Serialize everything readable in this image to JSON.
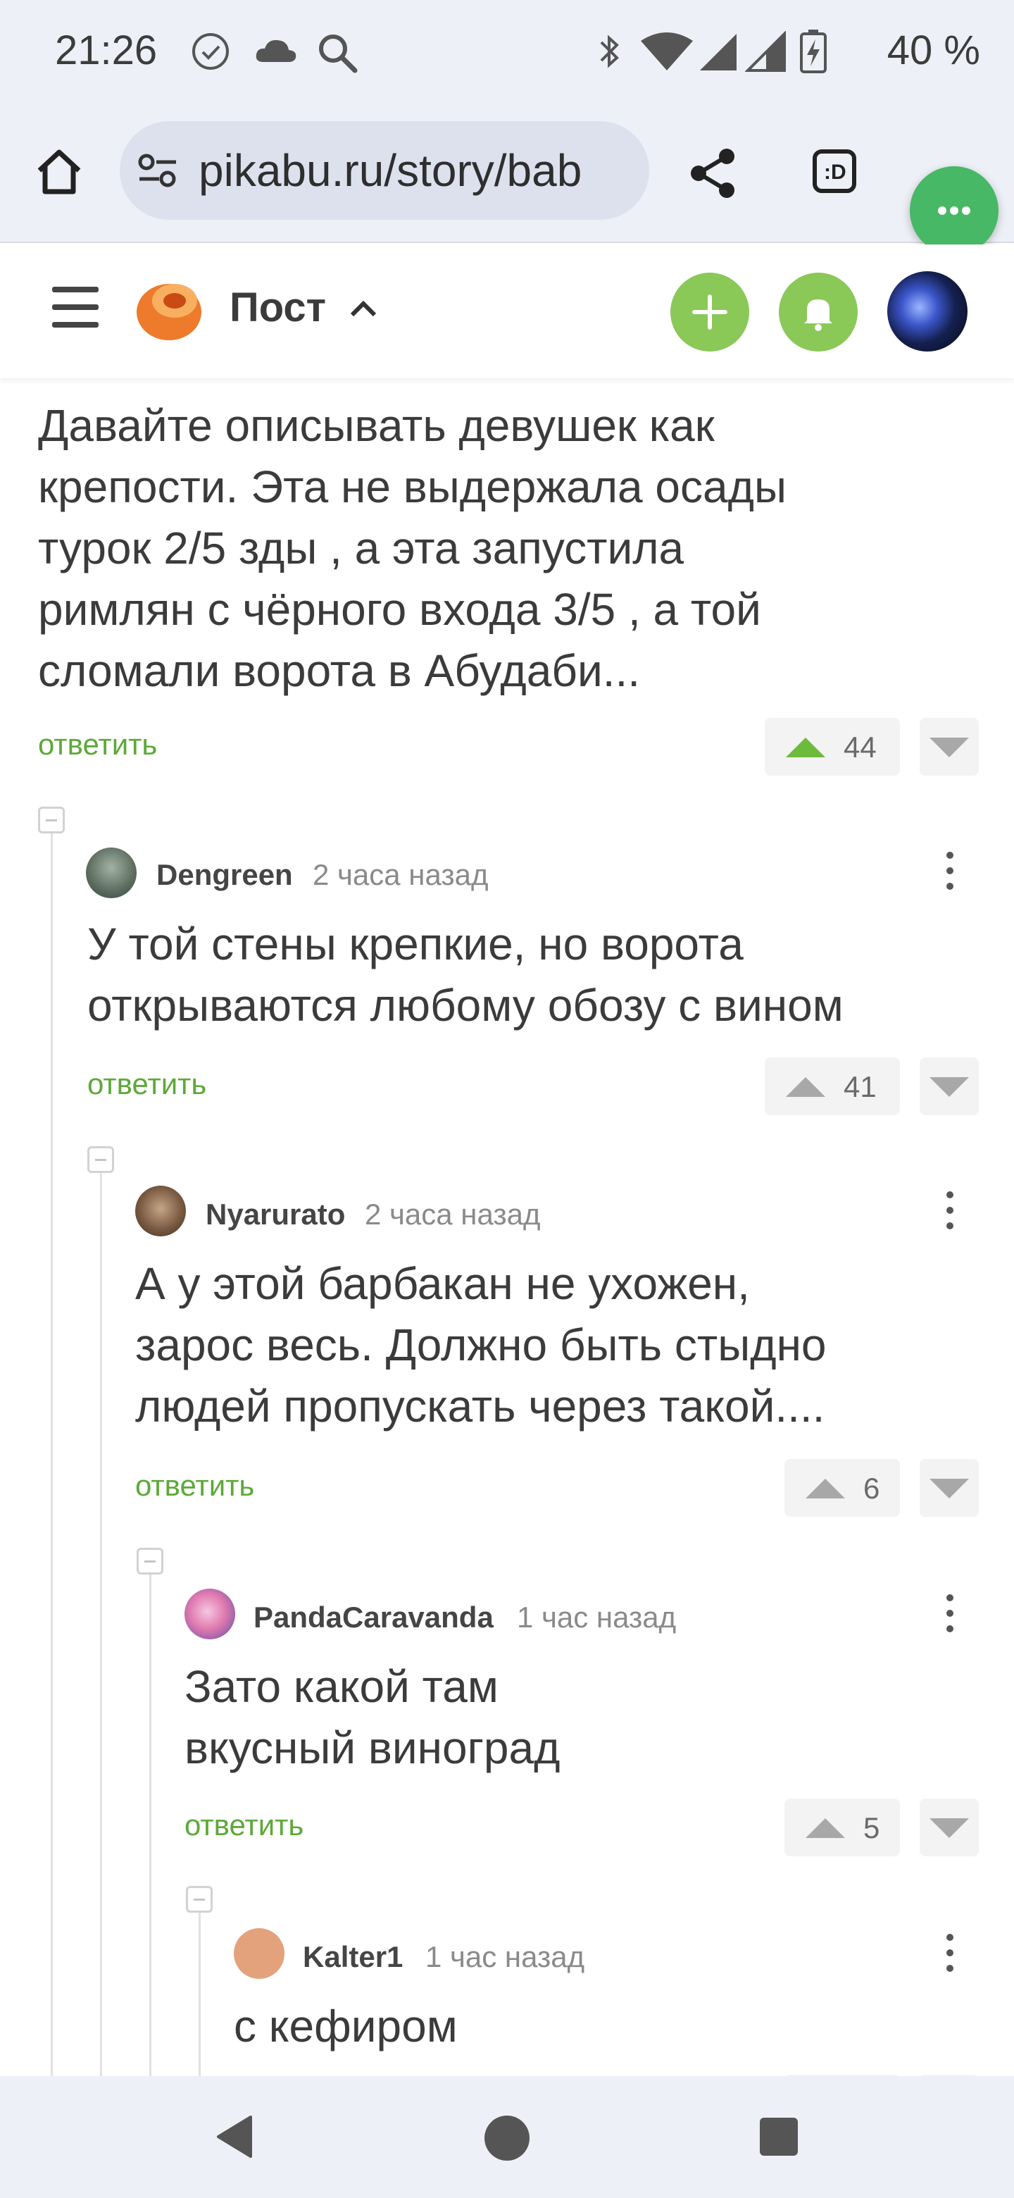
{
  "status_bar": {
    "time": "21:26",
    "battery": "40 %",
    "icons": [
      "check-circle-icon",
      "cloud-icon",
      "search-icon",
      "bluetooth-icon",
      "wifi-icon",
      "signal-icon",
      "signal-icon",
      "battery-charging-icon"
    ]
  },
  "browser": {
    "url": "pikabu.ru/story/bab",
    "icons": [
      "home-icon",
      "site-settings-icon",
      "share-icon",
      "reader-mode-icon",
      "more-menu-icon"
    ]
  },
  "site_header": {
    "post_title": "Пост",
    "icons": [
      "hamburger-icon",
      "pikabu-logo-icon",
      "chevron-up-icon",
      "plus-icon",
      "bell-icon"
    ],
    "colors": {
      "green": "#8ac858",
      "accent_reply": "#5ca938"
    }
  },
  "parent_comment": {
    "text_lines": [
      "Давайте описывать девушек как",
      "крепости. Эта не выдержала осады",
      "турок 2/5 зды , а эта запустила",
      "римлян с чёрного входа 3/5 , а той",
      "сломали ворота в Абудаби..."
    ],
    "reply_label": "ответить",
    "votes": "44"
  },
  "comments": [
    {
      "author": "Dengreen",
      "time": "2 часа назад",
      "text_lines": [
        "У той стены крепкие, но ворота",
        "открываются любому обозу с вином"
      ],
      "reply_label": "ответить",
      "votes": "41"
    },
    {
      "author": "Nyarurato",
      "time": "2 часа назад",
      "text_lines": [
        "А у этой барбакан не ухожен,",
        "зарос весь. Должно быть стыдно",
        "людей пропускать через такой...."
      ],
      "reply_label": "ответить",
      "votes": "6"
    },
    {
      "author": "PandaCaravanda",
      "time": "1 час назад",
      "text_lines": [
        "Зато какой там",
        "вкусный виноград"
      ],
      "reply_label": "ответить",
      "votes": "5"
    },
    {
      "author": "Kalter1",
      "time": "1 час назад",
      "text_lines": [
        "с кефиром"
      ]
    }
  ],
  "nav_bar": {
    "icons": [
      "back-icon",
      "home-circle-icon",
      "recents-square-icon"
    ]
  }
}
